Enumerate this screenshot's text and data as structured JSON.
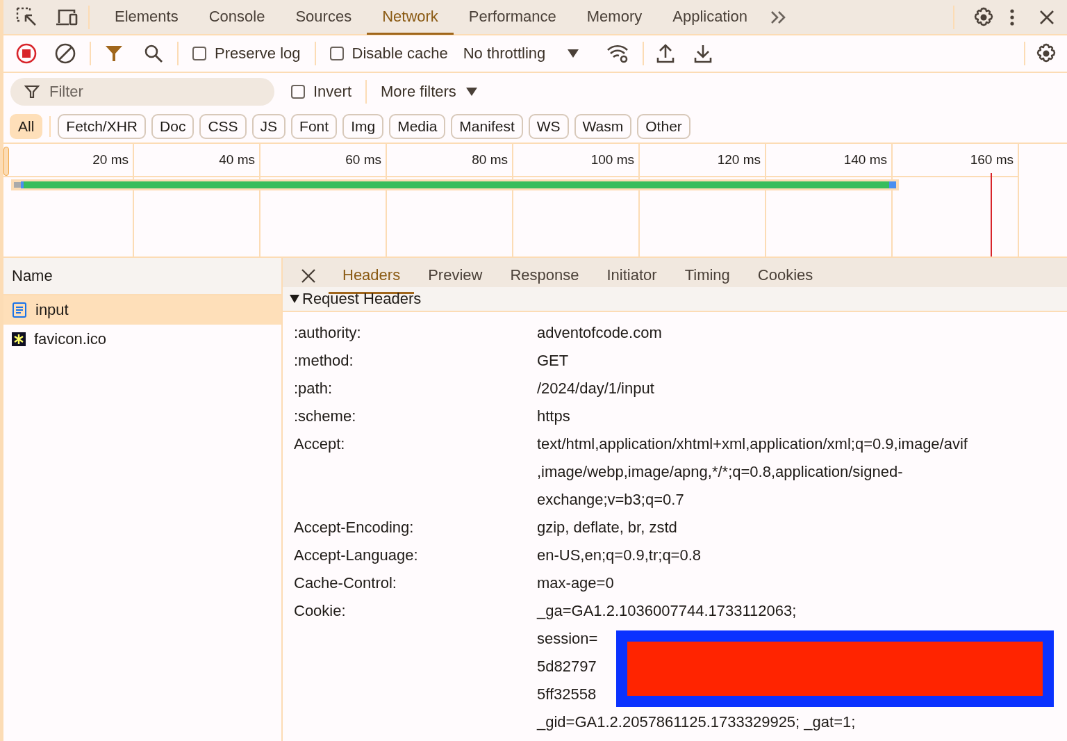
{
  "main_tabs": [
    {
      "label": "Elements",
      "selected": false
    },
    {
      "label": "Console",
      "selected": false
    },
    {
      "label": "Sources",
      "selected": false
    },
    {
      "label": "Network",
      "selected": true
    },
    {
      "label": "Performance",
      "selected": false
    },
    {
      "label": "Memory",
      "selected": false
    },
    {
      "label": "Application",
      "selected": false
    }
  ],
  "toolbar": {
    "recording": true,
    "preserve_log": {
      "label": "Preserve log",
      "checked": false
    },
    "disable_cache": {
      "label": "Disable cache",
      "checked": false
    },
    "throttling": "No throttling"
  },
  "filter": {
    "placeholder": "Filter",
    "invert": {
      "label": "Invert",
      "checked": false
    },
    "more_filters": "More filters"
  },
  "type_filters": [
    {
      "label": "All",
      "selected": true
    },
    {
      "label": "Fetch/XHR",
      "selected": false
    },
    {
      "label": "Doc",
      "selected": false
    },
    {
      "label": "CSS",
      "selected": false
    },
    {
      "label": "JS",
      "selected": false
    },
    {
      "label": "Font",
      "selected": false
    },
    {
      "label": "Img",
      "selected": false
    },
    {
      "label": "Media",
      "selected": false
    },
    {
      "label": "Manifest",
      "selected": false
    },
    {
      "label": "WS",
      "selected": false
    },
    {
      "label": "Wasm",
      "selected": false
    },
    {
      "label": "Other",
      "selected": false
    }
  ],
  "timeline": {
    "ticks": [
      "20 ms",
      "40 ms",
      "60 ms",
      "80 ms",
      "100 ms",
      "120 ms",
      "140 ms",
      "160 ms"
    ]
  },
  "requests": {
    "column": "Name",
    "rows": [
      {
        "name": "input",
        "kind": "document",
        "selected": true
      },
      {
        "name": "favicon.ico",
        "kind": "favicon",
        "selected": false
      }
    ]
  },
  "detail_tabs": [
    {
      "label": "Headers",
      "selected": true
    },
    {
      "label": "Preview",
      "selected": false
    },
    {
      "label": "Response",
      "selected": false
    },
    {
      "label": "Initiator",
      "selected": false
    },
    {
      "label": "Timing",
      "selected": false
    },
    {
      "label": "Cookies",
      "selected": false
    }
  ],
  "section": {
    "title": "Request Headers",
    "expanded": true,
    "headers": [
      {
        "name": ":authority:",
        "value": [
          "adventofcode.com"
        ]
      },
      {
        "name": ":method:",
        "value": [
          "GET"
        ]
      },
      {
        "name": ":path:",
        "value": [
          "/2024/day/1/input"
        ]
      },
      {
        "name": ":scheme:",
        "value": [
          "https"
        ]
      },
      {
        "name": "Accept:",
        "value": [
          "text/html,application/xhtml+xml,application/xml;q=0.9,image/avif",
          ",image/webp,image/apng,*/*;q=0.8,application/signed-",
          "exchange;v=b3;q=0.7"
        ]
      },
      {
        "name": "Accept-Encoding:",
        "value": [
          "gzip, deflate, br, zstd"
        ]
      },
      {
        "name": "Accept-Language:",
        "value": [
          "en-US,en;q=0.9,tr;q=0.8"
        ]
      },
      {
        "name": "Cache-Control:",
        "value": [
          "max-age=0"
        ]
      },
      {
        "name": "Cookie:",
        "value": [
          "_ga=GA1.2.1036007744.1733112063;",
          "session=",
          "5d82797",
          "5ff32558",
          "_gid=GA1.2.2057861125.1733329925; _gat=1;"
        ],
        "redacted": true
      }
    ]
  }
}
